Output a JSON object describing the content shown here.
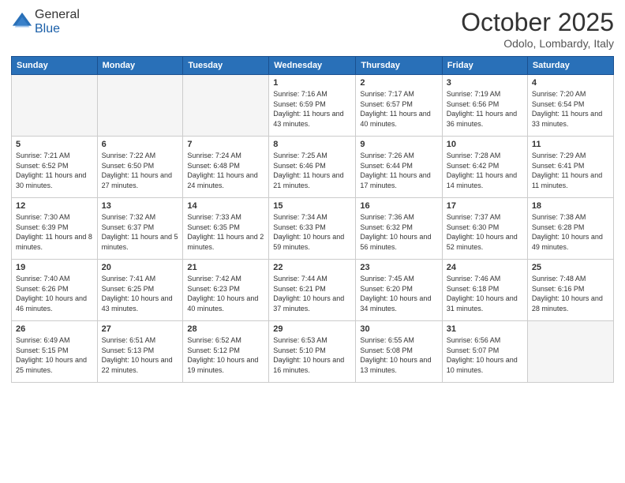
{
  "logo": {
    "general": "General",
    "blue": "Blue"
  },
  "title": "October 2025",
  "subtitle": "Odolo, Lombardy, Italy",
  "days_of_week": [
    "Sunday",
    "Monday",
    "Tuesday",
    "Wednesday",
    "Thursday",
    "Friday",
    "Saturday"
  ],
  "weeks": [
    [
      {
        "day": "",
        "empty": true
      },
      {
        "day": "",
        "empty": true
      },
      {
        "day": "",
        "empty": true
      },
      {
        "day": "1",
        "sunrise": "7:16 AM",
        "sunset": "6:59 PM",
        "daylight": "11 hours and 43 minutes."
      },
      {
        "day": "2",
        "sunrise": "7:17 AM",
        "sunset": "6:57 PM",
        "daylight": "11 hours and 40 minutes."
      },
      {
        "day": "3",
        "sunrise": "7:19 AM",
        "sunset": "6:56 PM",
        "daylight": "11 hours and 36 minutes."
      },
      {
        "day": "4",
        "sunrise": "7:20 AM",
        "sunset": "6:54 PM",
        "daylight": "11 hours and 33 minutes."
      }
    ],
    [
      {
        "day": "5",
        "sunrise": "7:21 AM",
        "sunset": "6:52 PM",
        "daylight": "11 hours and 30 minutes."
      },
      {
        "day": "6",
        "sunrise": "7:22 AM",
        "sunset": "6:50 PM",
        "daylight": "11 hours and 27 minutes."
      },
      {
        "day": "7",
        "sunrise": "7:24 AM",
        "sunset": "6:48 PM",
        "daylight": "11 hours and 24 minutes."
      },
      {
        "day": "8",
        "sunrise": "7:25 AM",
        "sunset": "6:46 PM",
        "daylight": "11 hours and 21 minutes."
      },
      {
        "day": "9",
        "sunrise": "7:26 AM",
        "sunset": "6:44 PM",
        "daylight": "11 hours and 17 minutes."
      },
      {
        "day": "10",
        "sunrise": "7:28 AM",
        "sunset": "6:42 PM",
        "daylight": "11 hours and 14 minutes."
      },
      {
        "day": "11",
        "sunrise": "7:29 AM",
        "sunset": "6:41 PM",
        "daylight": "11 hours and 11 minutes."
      }
    ],
    [
      {
        "day": "12",
        "sunrise": "7:30 AM",
        "sunset": "6:39 PM",
        "daylight": "11 hours and 8 minutes."
      },
      {
        "day": "13",
        "sunrise": "7:32 AM",
        "sunset": "6:37 PM",
        "daylight": "11 hours and 5 minutes."
      },
      {
        "day": "14",
        "sunrise": "7:33 AM",
        "sunset": "6:35 PM",
        "daylight": "11 hours and 2 minutes."
      },
      {
        "day": "15",
        "sunrise": "7:34 AM",
        "sunset": "6:33 PM",
        "daylight": "10 hours and 59 minutes."
      },
      {
        "day": "16",
        "sunrise": "7:36 AM",
        "sunset": "6:32 PM",
        "daylight": "10 hours and 56 minutes."
      },
      {
        "day": "17",
        "sunrise": "7:37 AM",
        "sunset": "6:30 PM",
        "daylight": "10 hours and 52 minutes."
      },
      {
        "day": "18",
        "sunrise": "7:38 AM",
        "sunset": "6:28 PM",
        "daylight": "10 hours and 49 minutes."
      }
    ],
    [
      {
        "day": "19",
        "sunrise": "7:40 AM",
        "sunset": "6:26 PM",
        "daylight": "10 hours and 46 minutes."
      },
      {
        "day": "20",
        "sunrise": "7:41 AM",
        "sunset": "6:25 PM",
        "daylight": "10 hours and 43 minutes."
      },
      {
        "day": "21",
        "sunrise": "7:42 AM",
        "sunset": "6:23 PM",
        "daylight": "10 hours and 40 minutes."
      },
      {
        "day": "22",
        "sunrise": "7:44 AM",
        "sunset": "6:21 PM",
        "daylight": "10 hours and 37 minutes."
      },
      {
        "day": "23",
        "sunrise": "7:45 AM",
        "sunset": "6:20 PM",
        "daylight": "10 hours and 34 minutes."
      },
      {
        "day": "24",
        "sunrise": "7:46 AM",
        "sunset": "6:18 PM",
        "daylight": "10 hours and 31 minutes."
      },
      {
        "day": "25",
        "sunrise": "7:48 AM",
        "sunset": "6:16 PM",
        "daylight": "10 hours and 28 minutes."
      }
    ],
    [
      {
        "day": "26",
        "sunrise": "6:49 AM",
        "sunset": "5:15 PM",
        "daylight": "10 hours and 25 minutes."
      },
      {
        "day": "27",
        "sunrise": "6:51 AM",
        "sunset": "5:13 PM",
        "daylight": "10 hours and 22 minutes."
      },
      {
        "day": "28",
        "sunrise": "6:52 AM",
        "sunset": "5:12 PM",
        "daylight": "10 hours and 19 minutes."
      },
      {
        "day": "29",
        "sunrise": "6:53 AM",
        "sunset": "5:10 PM",
        "daylight": "10 hours and 16 minutes."
      },
      {
        "day": "30",
        "sunrise": "6:55 AM",
        "sunset": "5:08 PM",
        "daylight": "10 hours and 13 minutes."
      },
      {
        "day": "31",
        "sunrise": "6:56 AM",
        "sunset": "5:07 PM",
        "daylight": "10 hours and 10 minutes."
      },
      {
        "day": "",
        "empty": true
      }
    ]
  ],
  "labels": {
    "sunrise": "Sunrise:",
    "sunset": "Sunset:",
    "daylight": "Daylight:"
  }
}
